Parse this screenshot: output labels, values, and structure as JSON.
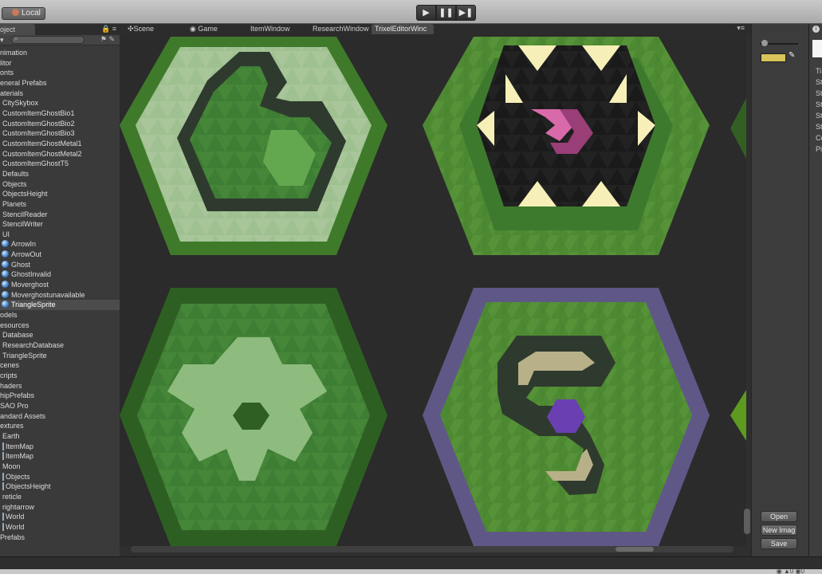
{
  "toolbar": {
    "local_label": "Local",
    "play_glyph": "▶",
    "pause_glyph": "❚❚",
    "step_glyph": "▶❚"
  },
  "left_panel": {
    "tab_label": "oject",
    "lock_glyph": "🔒 ≡",
    "create_glyph": "▾",
    "filter_glyphs": "⚑ ✎",
    "tree": [
      {
        "label": "nimation",
        "indent": 0
      },
      {
        "label": "litor",
        "indent": 0
      },
      {
        "label": "onts",
        "indent": 0
      },
      {
        "label": "eneral Prefabs",
        "indent": 0
      },
      {
        "label": "aterials",
        "indent": 0
      },
      {
        "label": "CitySkybox",
        "indent": 1
      },
      {
        "label": "CustomItemGhostBio1",
        "indent": 1
      },
      {
        "label": "CustomItemGhostBio2",
        "indent": 1
      },
      {
        "label": "CustomItemGhostBio3",
        "indent": 1
      },
      {
        "label": "CustomItemGhostMetal1",
        "indent": 1
      },
      {
        "label": "CustomItemGhostMetal2",
        "indent": 1
      },
      {
        "label": "CustomItemGhostT5",
        "indent": 1
      },
      {
        "label": "Defaults",
        "indent": 1
      },
      {
        "label": "Objects",
        "indent": 1
      },
      {
        "label": "ObjectsHeight",
        "indent": 1
      },
      {
        "label": "Planets",
        "indent": 1
      },
      {
        "label": "StencilReader",
        "indent": 1
      },
      {
        "label": "StencilWriter",
        "indent": 1
      },
      {
        "label": "UI",
        "indent": 1
      },
      {
        "label": "ArrowIn",
        "indent": 2,
        "orb": true
      },
      {
        "label": "ArrowOut",
        "indent": 2,
        "orb": true
      },
      {
        "label": "Ghost",
        "indent": 2,
        "orb": true
      },
      {
        "label": "GhostInvalid",
        "indent": 2,
        "orb": true
      },
      {
        "label": "Moverghost",
        "indent": 2,
        "orb": true
      },
      {
        "label": "Moverghostunavailable",
        "indent": 2,
        "orb": true
      },
      {
        "label": "TriangleSprite",
        "indent": 2,
        "orb": true,
        "selected": true
      },
      {
        "label": "odels",
        "indent": 0
      },
      {
        "label": "esources",
        "indent": 0
      },
      {
        "label": "Database",
        "indent": 1
      },
      {
        "label": "ResearchDatabase",
        "indent": 1
      },
      {
        "label": "TriangleSprite",
        "indent": 1
      },
      {
        "label": "cenes",
        "indent": 0
      },
      {
        "label": "cripts",
        "indent": 0
      },
      {
        "label": "haders",
        "indent": 0
      },
      {
        "label": "hipPrefabs",
        "indent": 0
      },
      {
        "label": "SAO Pro",
        "indent": 0
      },
      {
        "label": "andard Assets",
        "indent": 0
      },
      {
        "label": "extures",
        "indent": 0
      },
      {
        "label": "Earth",
        "indent": 1
      },
      {
        "label": "ItemMap",
        "indent": 1,
        "bar": true
      },
      {
        "label": "ItemMap",
        "indent": 1,
        "bar": true
      },
      {
        "label": "Moon",
        "indent": 1
      },
      {
        "label": "Objects",
        "indent": 1,
        "bar": true
      },
      {
        "label": "ObjectsHeight",
        "indent": 1,
        "bar": true
      },
      {
        "label": "reticle",
        "indent": 1
      },
      {
        "label": "rightarrow",
        "indent": 1
      },
      {
        "label": "World",
        "indent": 1,
        "bar": true
      },
      {
        "label": "World",
        "indent": 1,
        "bar": true
      },
      {
        "label": "Prefabs",
        "indent": 0
      }
    ]
  },
  "center": {
    "tabs": [
      {
        "label": "Scene",
        "icon": "✣"
      },
      {
        "label": "Game",
        "icon": "◉"
      },
      {
        "label": "ItemWindow",
        "icon": ""
      },
      {
        "label": "ResearchWindow",
        "icon": ""
      },
      {
        "label": "TrixelEditorWinc",
        "icon": "",
        "active": true
      }
    ],
    "menu_glyph": "▾≡"
  },
  "tools": {
    "color": "#d8c45a",
    "brush_glyph": "✎",
    "open_label": "Open",
    "new_image_label": "New Imag",
    "save_label": "Save"
  },
  "inspector": {
    "info_glyph": "i",
    "rows": [
      "Ti",
      "St",
      "St",
      "St",
      "St",
      "St",
      "Co",
      "Pi"
    ]
  },
  "status": {
    "icons": "◉ ▲0 ◉0"
  }
}
